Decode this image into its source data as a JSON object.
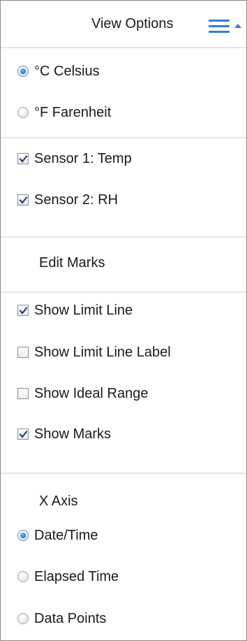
{
  "header": {
    "title": "View Options",
    "menu_icon": "hamburger-menu-icon"
  },
  "colors": {
    "accent": "#2f7fd6",
    "radio_selected": "#2e74c6",
    "check_mark": "#27407a",
    "divider": "#e6e6e6"
  },
  "units": {
    "options": [
      {
        "label": "°C Celsius",
        "selected": true
      },
      {
        "label": "°F Farenheit",
        "selected": false
      }
    ]
  },
  "sensors": {
    "items": [
      {
        "label": "Sensor 1: Temp",
        "checked": true
      },
      {
        "label": "Sensor 2: RH",
        "checked": true
      }
    ]
  },
  "edit_marks": {
    "label": "Edit Marks"
  },
  "display": {
    "items": [
      {
        "label": "Show Limit Line",
        "checked": true
      },
      {
        "label": "Show Limit Line Label",
        "checked": false
      },
      {
        "label": "Show Ideal Range",
        "checked": false
      },
      {
        "label": "Show Marks",
        "checked": true
      }
    ]
  },
  "x_axis": {
    "heading": "X Axis",
    "options": [
      {
        "label": "Date/Time",
        "selected": true
      },
      {
        "label": "Elapsed Time",
        "selected": false
      },
      {
        "label": "Data Points",
        "selected": false
      }
    ]
  }
}
